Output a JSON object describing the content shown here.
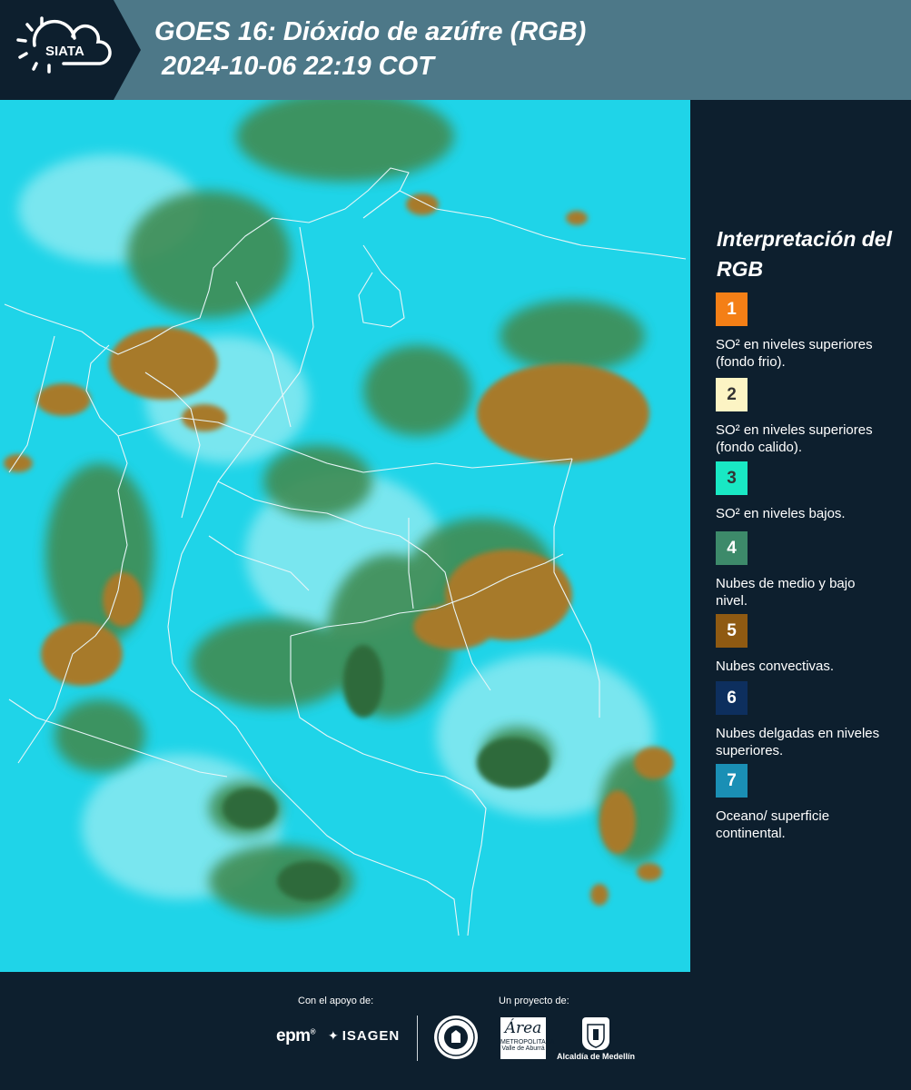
{
  "header": {
    "logo_text": "SIATA",
    "title_line1": "GOES 16: Dióxido de azúfre (RGB)",
    "title_line2": "2024-10-06 22:19 COT"
  },
  "legend": {
    "title": "Interpretación del RGB",
    "items": [
      {
        "number": "1",
        "color": "#f47f16",
        "label": "SO² en niveles superiores (fondo frio)."
      },
      {
        "number": "2",
        "color": "#fcf4c4",
        "label": "SO² en niveles superiores (fondo calido)."
      },
      {
        "number": "3",
        "color": "#19e8c4",
        "label": "SO² en niveles bajos."
      },
      {
        "number": "4",
        "color": "#3d8a6a",
        "label": "Nubes de medio y bajo nivel."
      },
      {
        "number": "5",
        "color": "#8f5a12",
        "label": "Nubes convectivas."
      },
      {
        "number": "6",
        "color": "#0d2f5e",
        "label": "Nubes delgadas en niveles superiores."
      },
      {
        "number": "7",
        "color": "#1a8fb5",
        "label": "Oceano/ superficie continental."
      }
    ]
  },
  "footer": {
    "support_label": "Con el apoyo de:",
    "project_label": "Un proyecto de:",
    "epm": "epm",
    "isagen": "ISAGEN",
    "area_script": "Área",
    "area_line1": "METROPOLITANA",
    "area_line2": "Valle de Aburrá",
    "alcaldia": "Alcaldía de Medellín"
  },
  "colors": {
    "header_bg": "#4d7888",
    "panel_bg": "#0d1f2e",
    "sky": "#1ed2e6"
  }
}
